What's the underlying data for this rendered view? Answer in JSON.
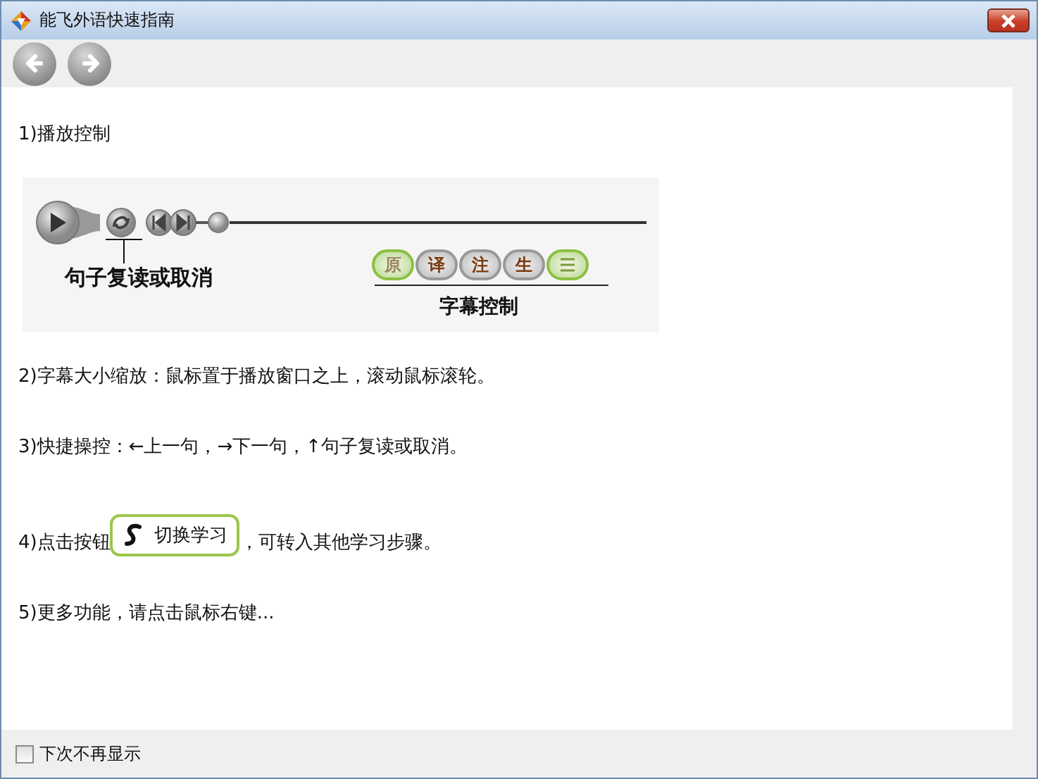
{
  "window": {
    "title": "能飞外语快速指南"
  },
  "toolbar": {
    "buttons": [
      {
        "kind": "back"
      },
      {
        "kind": "forward"
      }
    ]
  },
  "sections": [
    {
      "kind": "text",
      "text": "1)播放控制"
    },
    {
      "kind": "player",
      "repeat_label": "句子复读或取消",
      "subtitle_label": "字幕控制",
      "subtitle_buttons": [
        {
          "kind": "letter",
          "label": "原",
          "selected": true
        },
        {
          "kind": "letter",
          "label": "译",
          "selected": false
        },
        {
          "kind": "letter",
          "label": "注",
          "selected": false
        },
        {
          "kind": "letter",
          "label": "生",
          "selected": false
        },
        {
          "kind": "lines",
          "selected": true
        }
      ]
    },
    {
      "kind": "text",
      "text": "2)字幕大小缩放：鼠标置于播放窗口之上，滚动鼠标滚轮。"
    },
    {
      "kind": "text",
      "text": "3)快捷操控：←上一句，→下一句，↑句子复读或取消。"
    },
    {
      "kind": "button_line",
      "before": "4)点击按钮",
      "button": "切换学习",
      "after": "，可转入其他学习步骤。"
    },
    {
      "kind": "text",
      "text": "5)更多功能，请点击鼠标右键..."
    }
  ],
  "footer": {
    "checkbox": {
      "label": "下次不再显示",
      "checked": false
    }
  }
}
